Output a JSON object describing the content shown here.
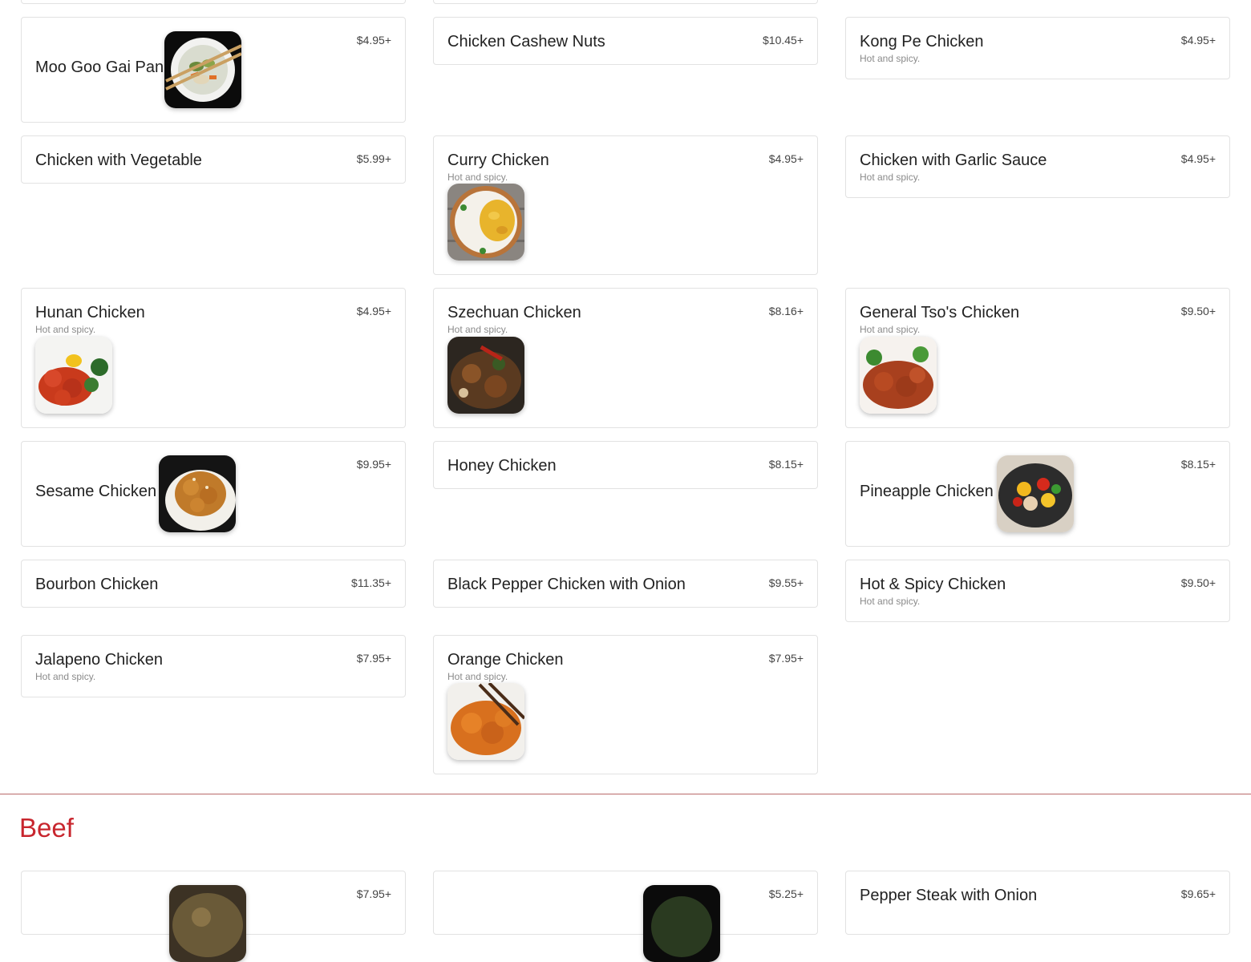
{
  "colors": {
    "accent": "#c8262e",
    "card_border": "#e2e2e2",
    "price": "#444444",
    "desc": "#8a8a8a"
  },
  "items": {
    "moo_goo": {
      "name": "Moo Goo Gai Pan",
      "price": "$4.95+"
    },
    "cashew": {
      "name": "Chicken Cashew Nuts",
      "price": "$10.45+"
    },
    "kong_pe": {
      "name": "Kong Pe Chicken",
      "price": "$4.95+",
      "desc": "Hot and spicy."
    },
    "with_vegetable": {
      "name": "Chicken with Vegetable",
      "price": "$5.99+"
    },
    "curry": {
      "name": "Curry Chicken",
      "price": "$4.95+",
      "desc": "Hot and spicy."
    },
    "garlic": {
      "name": "Chicken with Garlic Sauce",
      "price": "$4.95+",
      "desc": "Hot and spicy."
    },
    "hunan": {
      "name": "Hunan Chicken",
      "price": "$4.95+",
      "desc": "Hot and spicy."
    },
    "szechuan": {
      "name": "Szechuan Chicken",
      "price": "$8.16+",
      "desc": "Hot and spicy."
    },
    "general_tso": {
      "name": "General Tso's Chicken",
      "price": "$9.50+",
      "desc": "Hot and spicy."
    },
    "sesame": {
      "name": "Sesame Chicken",
      "price": "$9.95+"
    },
    "honey": {
      "name": "Honey Chicken",
      "price": "$8.15+"
    },
    "pineapple": {
      "name": "Pineapple Chicken",
      "price": "$8.15+"
    },
    "bourbon": {
      "name": "Bourbon Chicken",
      "price": "$11.35+"
    },
    "black_pepper": {
      "name": "Black Pepper Chicken with Onion",
      "price": "$9.55+"
    },
    "hot_spicy": {
      "name": "Hot & Spicy Chicken",
      "price": "$9.50+",
      "desc": "Hot and spicy."
    },
    "jalapeno": {
      "name": "Jalapeno Chicken",
      "price": "$7.95+",
      "desc": "Hot and spicy."
    },
    "orange": {
      "name": "Orange Chicken",
      "price": "$7.95+",
      "desc": "Hot and spicy."
    }
  },
  "beef_section": {
    "title": "Beef",
    "items": [
      {
        "name": "",
        "price": "$7.95+"
      },
      {
        "name": "",
        "price": "$5.25+"
      },
      {
        "name": "Pepper Steak with Onion",
        "price": "$9.65+"
      }
    ]
  }
}
